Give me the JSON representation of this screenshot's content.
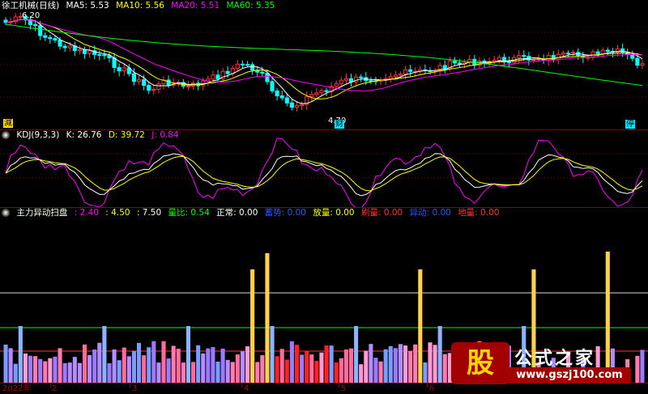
{
  "main": {
    "title": "徐工机械(日线)",
    "ma": [
      {
        "label": "MA5: 5.53",
        "color": "#ffffff"
      },
      {
        "label": "MA10: 5.56",
        "color": "#ffff00"
      },
      {
        "label": "MA20: 5.51",
        "color": "#ff00ff"
      },
      {
        "label": "MA60: 5.35",
        "color": "#00ff00"
      }
    ],
    "high_label": "6.20",
    "low_label": "4.70",
    "marker_left": "減",
    "marker_mid": "财",
    "marker_right": "停"
  },
  "kdj": {
    "title": "KDJ(9,3,3)",
    "k": "K: 26.76",
    "d": "D: 39.72",
    "j": "J: 0.84"
  },
  "vol": {
    "title": "主力异动扫盘",
    "items": [
      {
        "label": ": 2.40",
        "color": "#ff00ff"
      },
      {
        "label": ": 4.50",
        "color": "#ffff00"
      },
      {
        "label": ": 7.50",
        "color": "#ffffff"
      },
      {
        "label": "量比: 0.54",
        "color": "#00ff00"
      },
      {
        "label": "正常: 0.00",
        "color": "#ffffff"
      },
      {
        "label": "蓄势: 0.00",
        "color": "#0000ff"
      },
      {
        "label": "放量: 0.00",
        "color": "#ffff00"
      },
      {
        "label": "刷量: 0.00",
        "color": "#ff0000"
      },
      {
        "label": "异动: 0.00",
        "color": "#0000ff"
      },
      {
        "label": "地量: 0.00",
        "color": "#ff0000"
      }
    ]
  },
  "xaxis": {
    "labels": [
      "2022年",
      "2",
      "3",
      "4",
      "5",
      "6"
    ]
  },
  "watermark": {
    "logo": "股",
    "title": "公式之家",
    "url": "www.gszj100.com"
  },
  "colors": {
    "up": "#ff3333",
    "down": "#00ffff",
    "grid": "#8b0000",
    "ma5": "#ffffff",
    "ma10": "#ffff00",
    "ma20": "#ff00ff",
    "ma60": "#00ff00"
  }
}
